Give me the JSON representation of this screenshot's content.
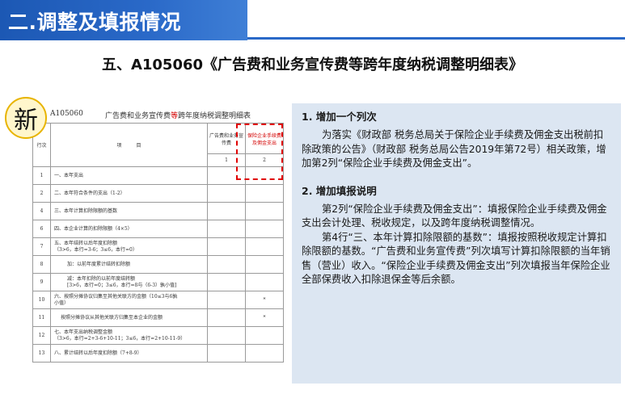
{
  "header": {
    "section_title": "二.调整及填报情况",
    "page_title": "五、A105060《广告费和业务宣传费等跨年度纳税调整明细表》"
  },
  "badge": {
    "label": "新"
  },
  "form": {
    "code": "A105060",
    "title_pre": "广告费和业务宣传费",
    "title_highlight": "等",
    "title_post": "跨年度纳税调整明细表",
    "columns": {
      "row_no": "行次",
      "item": "项　　　目",
      "col1": "广告费和业务宣传费",
      "col2": "保险企业手续费及佣金支出",
      "col1_num": "1",
      "col2_num": "2"
    },
    "rows": [
      {
        "no": "1",
        "item": "一、本年支出",
        "c2": ""
      },
      {
        "no": "2",
        "item": "二、本年符合条件的支出（1-2）",
        "c2": ""
      },
      {
        "no": "4",
        "item": "三、本年计算扣除限额的基数",
        "c2": ""
      },
      {
        "no": "6",
        "item": "四、本企业计算的扣除限额（4×5）",
        "c2": ""
      },
      {
        "no": "7",
        "item": "五、本年结转以后年度扣除额\n（3>6，本行=3-6；3≤6，本行=0）",
        "c2": ""
      },
      {
        "no": "8",
        "item": "加：以前年度累计结转扣除额",
        "c2": ""
      },
      {
        "no": "9",
        "item": "减：本年扣除的以前年度结转额\n[3>6，本行=0；3≤6，本行=8与（6-3）孰小值]",
        "c2": ""
      },
      {
        "no": "10",
        "item": "六、按照分摊协议归集至其他关联方的金额（10≤3与6孰\n小值）",
        "c2": "*"
      },
      {
        "no": "11",
        "item": "按照分摊协议从其他关联方归集至本企业的金额",
        "c2": "*"
      },
      {
        "no": "12",
        "item": "七、本年支出纳税调整金额\n（3>6，本行=2+3-6+10-11；3≤6，本行=2+10-11-9）",
        "c2": ""
      },
      {
        "no": "13",
        "item": "八、累计结转以后年度扣除额（7+8-9）",
        "c2": ""
      }
    ]
  },
  "panel": {
    "sec1_title": "1. 增加一个列次",
    "sec1_body": "为落实《财政部 税务总局关于保险企业手续费及佣金支出税前扣除政策的公告》（财政部 税务总局公告2019年第72号）相关政策，增加第2列“保险企业手续费及佣金支出”。",
    "sec2_title": "2. 增加填报说明",
    "sec2_body1": "第2列“保险企业手续费及佣金支出”：填报保险企业手续费及佣金支出会计处理、税收规定，以及跨年度纳税调整情况。",
    "sec2_body2": "第4行“三、本年计算扣除限额的基数”：填报按照税收规定计算扣除限额的基数。“广告费和业务宣传费”列次填写计算扣除限额的当年销售（营业）收入。“保险企业手续费及佣金支出”列次填报当年保险企业全部保费收入扣除退保金等后余额。"
  }
}
